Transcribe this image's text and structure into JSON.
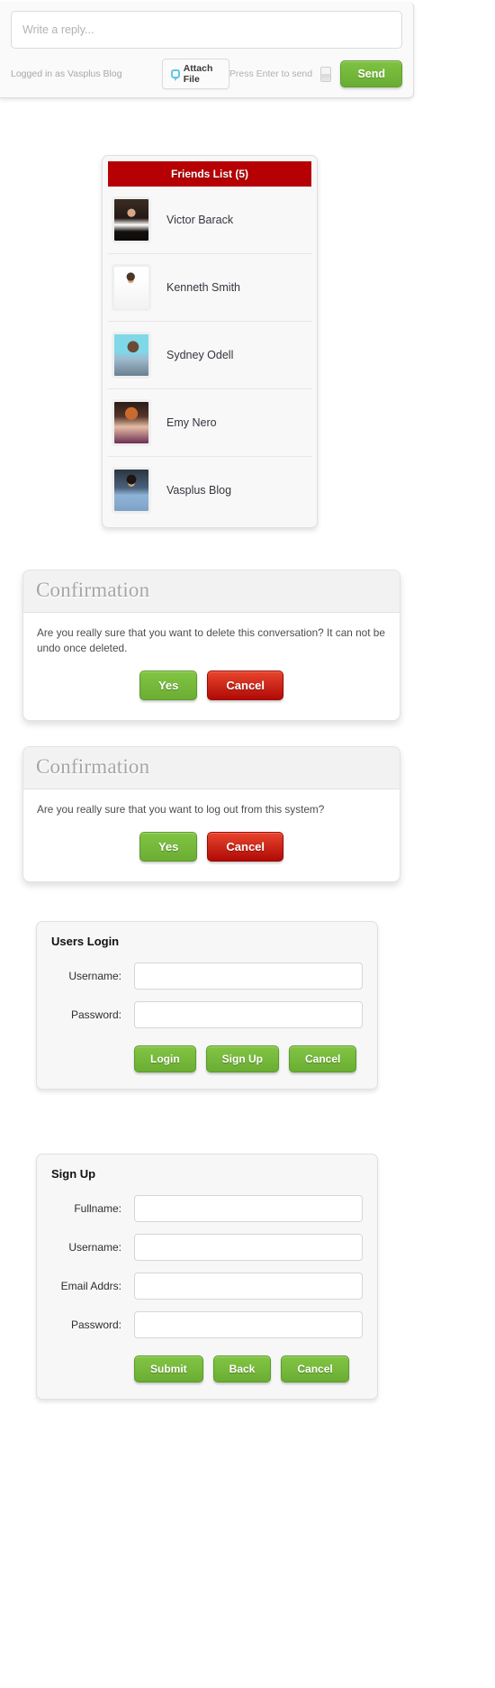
{
  "reply_box": {
    "input_placeholder": "Write a reply...",
    "logged_in_text": "Logged in as Vasplus Blog",
    "attach_label": "Attach File",
    "attach_icon": "comment-bubble-icon",
    "press_enter_text": "Press Enter to send",
    "send_label": "Send"
  },
  "friends_list": {
    "header": "Friends List (5)",
    "count": 5,
    "friends": [
      {
        "name": "Victor Barack",
        "avatar": "avatar-victor-barack"
      },
      {
        "name": "Kenneth Smith",
        "avatar": "avatar-kenneth-smith"
      },
      {
        "name": "Sydney Odell",
        "avatar": "avatar-sydney-odell"
      },
      {
        "name": "Emy Nero",
        "avatar": "avatar-emy-nero"
      },
      {
        "name": "Vasplus Blog",
        "avatar": "avatar-vasplus-blog"
      }
    ]
  },
  "delete_confirmation": {
    "title": "Confirmation",
    "message": "Are you really sure that you want to delete this conversation? It can not be undo once deleted.",
    "yes_label": "Yes",
    "cancel_label": "Cancel"
  },
  "logout_confirmation": {
    "title": "Confirmation",
    "message": "Are you really sure that you want to log out from this system?",
    "yes_label": "Yes",
    "cancel_label": "Cancel"
  },
  "login_form": {
    "title": "Users Login",
    "fields": [
      {
        "label": "Username:",
        "value": "",
        "placeholder": ""
      },
      {
        "label": "Password:",
        "value": "",
        "placeholder": ""
      }
    ],
    "buttons": [
      {
        "label": "Login"
      },
      {
        "label": "Sign Up"
      },
      {
        "label": "Cancel"
      }
    ]
  },
  "signup_form": {
    "title": "Sign Up",
    "fields": [
      {
        "label": "Fullname:",
        "value": "",
        "placeholder": ""
      },
      {
        "label": "Username:",
        "value": "",
        "placeholder": ""
      },
      {
        "label": "Email Addrs:",
        "value": "",
        "placeholder": ""
      },
      {
        "label": "Password:",
        "value": "",
        "placeholder": ""
      }
    ],
    "buttons": [
      {
        "label": "Submit"
      },
      {
        "label": "Back"
      },
      {
        "label": "Cancel"
      }
    ]
  },
  "colors": {
    "friends_header_red": "#b70003",
    "button_green": "#6aad33",
    "button_red": "#b00a06",
    "panel_grey": "#f7f7f7"
  }
}
